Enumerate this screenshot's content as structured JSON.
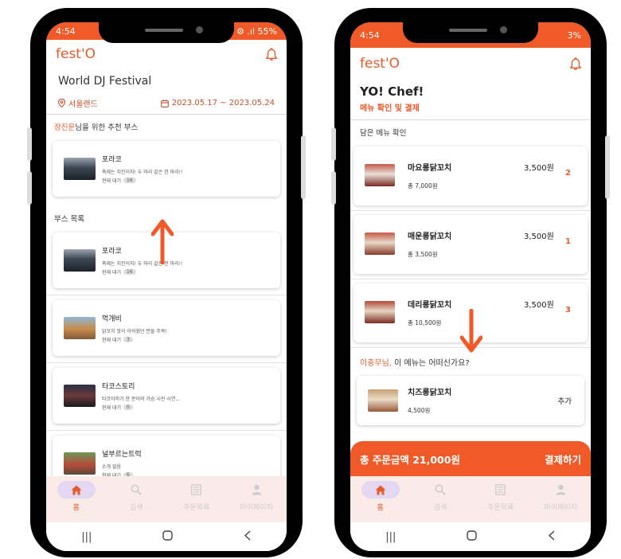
{
  "left": {
    "status_time": "4:54",
    "status_right": "⚙ .ıl 55%",
    "app_title": "fest'O",
    "festival_name": "World DJ Festival",
    "location": "서울랜드",
    "dates": "2023.05.17 ~ 2023.05.24",
    "recommend_user": "장진문",
    "recommend_suffix": "님을 위한 추천 부스",
    "recommended": {
      "name": "포라코",
      "desc": "축제는 치킨이지! 두 마리 같은 한 마리!!",
      "wait_label": "현재 대기",
      "wait_count": "16"
    },
    "booth_list_title": "부스 목록",
    "booths": [
      {
        "name": "포라코",
        "desc": "축제는 치킨이지! 두 마리 같은 한 마리!!",
        "wait_label": "현재 대기",
        "wait_count": "16"
      },
      {
        "name": "먹개비",
        "desc": "닭꼬치 맛이 아쉬웠던 분들 주목!",
        "wait_label": "현재 대기",
        "wait_count": "3"
      },
      {
        "name": "타코스토리",
        "desc": "타코야끼가 한 문어의 가슴 시린 사연...",
        "wait_label": "현재 대기",
        "wait_count": "0"
      },
      {
        "name": "널부르는트럭",
        "desc": "소개 없음",
        "wait_label": "현재 대기",
        "wait_count": "6"
      }
    ]
  },
  "right": {
    "status_time": "4:54",
    "status_right": "3%",
    "app_title": "fest'O",
    "booth_title": "YO! Chef!",
    "page_subtitle": "메뉴 확인 및 결제",
    "cart_title": "담은 메뉴 확인",
    "items": [
      {
        "name": "마요롱닭꼬치",
        "price": "3,500원",
        "total": "총 7,000원",
        "qty": "2"
      },
      {
        "name": "매운롱닭꼬치",
        "price": "3,500원",
        "total": "총 3,500원",
        "qty": "1"
      },
      {
        "name": "데리롱닭꼬치",
        "price": "3,500원",
        "total": "총 10,500원",
        "qty": "3"
      }
    ],
    "rec_user": "이충무님,",
    "rec_suffix": " 이 메뉴는 어떠신가요?",
    "rec_item": {
      "name": "치즈롱닭꼬치",
      "price": "4,500원",
      "add": "추가"
    },
    "order_total": "총 주문금액  21,000원",
    "pay_label": "결제하기"
  },
  "nav": [
    {
      "label": "홈",
      "icon": "home-icon"
    },
    {
      "label": "검색",
      "icon": "search-icon"
    },
    {
      "label": "주문목록",
      "icon": "receipt-icon"
    },
    {
      "label": "마이페이지",
      "icon": "person-icon"
    }
  ],
  "colors": {
    "accent": "#f05a28",
    "nav_bg": "#fbebe8",
    "active_pill": "#e3d7f2"
  }
}
